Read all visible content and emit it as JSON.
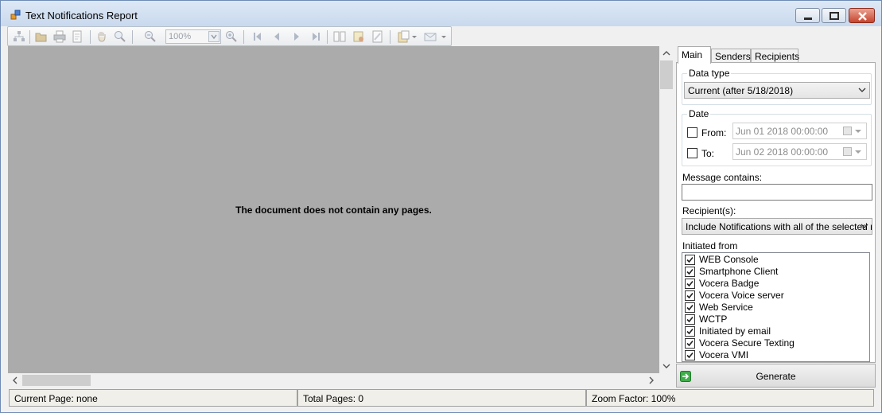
{
  "window": {
    "title": "Text Notifications Report"
  },
  "toolbar": {
    "zoom_value": "100%"
  },
  "preview": {
    "empty_message": "The document does not contain any pages."
  },
  "tabs": [
    {
      "label": "Main",
      "active": true
    },
    {
      "label": "Senders",
      "active": false
    },
    {
      "label": "Recipients",
      "active": false
    }
  ],
  "main_tab": {
    "data_type": {
      "legend": "Data type",
      "selected": "Current (after 5/18/2018)"
    },
    "date": {
      "legend": "Date",
      "from_label": "From:",
      "from_value": "Jun  01 2018 00:00:00",
      "to_label": "To:",
      "to_value": "Jun  02 2018 00:00:00"
    },
    "message_contains": {
      "label": "Message contains:",
      "value": ""
    },
    "recipients": {
      "label": "Recipient(s):",
      "selected": "Include Notifications with all of the selected re"
    },
    "initiated_from": {
      "label": "Initiated from",
      "items": [
        {
          "label": "WEB Console",
          "checked": true
        },
        {
          "label": "Smartphone Client",
          "checked": true
        },
        {
          "label": "Vocera Badge",
          "checked": true
        },
        {
          "label": "Vocera Voice server",
          "checked": true
        },
        {
          "label": "Web Service",
          "checked": true
        },
        {
          "label": "WCTP",
          "checked": true
        },
        {
          "label": "Initiated by email",
          "checked": true
        },
        {
          "label": "Vocera Secure Texting",
          "checked": true
        },
        {
          "label": "Vocera VMI",
          "checked": true
        }
      ]
    }
  },
  "generate": {
    "label": "Generate"
  },
  "status": {
    "current_page": "Current Page: none",
    "total_pages": "Total Pages: 0",
    "zoom_factor": "Zoom Factor: 100%"
  }
}
